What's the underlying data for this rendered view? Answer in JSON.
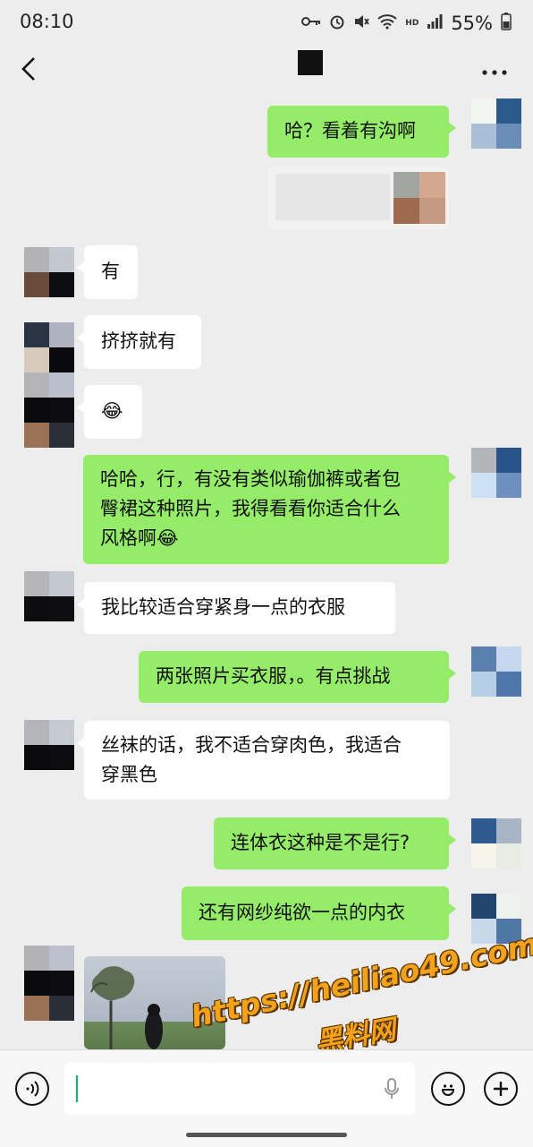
{
  "status_bar": {
    "time": "08:10",
    "network": "HD",
    "battery": "55%"
  },
  "header": {
    "back_label": "<",
    "more_label": "···"
  },
  "messages": [
    {
      "side": "me",
      "text": "哈？看着有沟啊"
    },
    {
      "side": "me",
      "text": ""
    },
    {
      "side": "them",
      "text": "有"
    },
    {
      "side": "them",
      "text": "挤挤就有"
    },
    {
      "side": "them",
      "text": "😂"
    },
    {
      "side": "me",
      "text": "哈哈，行，有没有类似瑜伽裤或者包臀裙这种照片，我得看看你适合什么风格啊😂"
    },
    {
      "side": "them",
      "text": "我比较适合穿紧身一点的衣服"
    },
    {
      "side": "me",
      "text": "两张照片买衣服，。有点挑战"
    },
    {
      "side": "them",
      "text": "丝袜的话，我不适合穿肉色，我适合穿黑色"
    },
    {
      "side": "me",
      "text": "连体衣这种是不是行?"
    },
    {
      "side": "me",
      "text": "还有网纱纯欲一点的内衣"
    }
  ],
  "message_lines": {
    "m6": [
      "哈哈，行，有没有类似瑜伽裤或者包",
      "臀裙这种照片，我得看看你适合什么",
      "风格啊😂"
    ],
    "m9": [
      "丝袜的话，我不适合穿肉色，我适合",
      "穿黑色"
    ]
  },
  "watermark": {
    "url": "https://heiliao49.com",
    "name": "黑料网"
  },
  "colors": {
    "bg": "#ededed",
    "me_bubble": "#95ec69",
    "them_bubble": "#ffffff",
    "caret": "#07c160",
    "watermark": "#f2a31b"
  },
  "icons": [
    "back-icon",
    "more-icon",
    "voice-icon",
    "mic-icon",
    "emoji-icon",
    "plus-icon"
  ]
}
